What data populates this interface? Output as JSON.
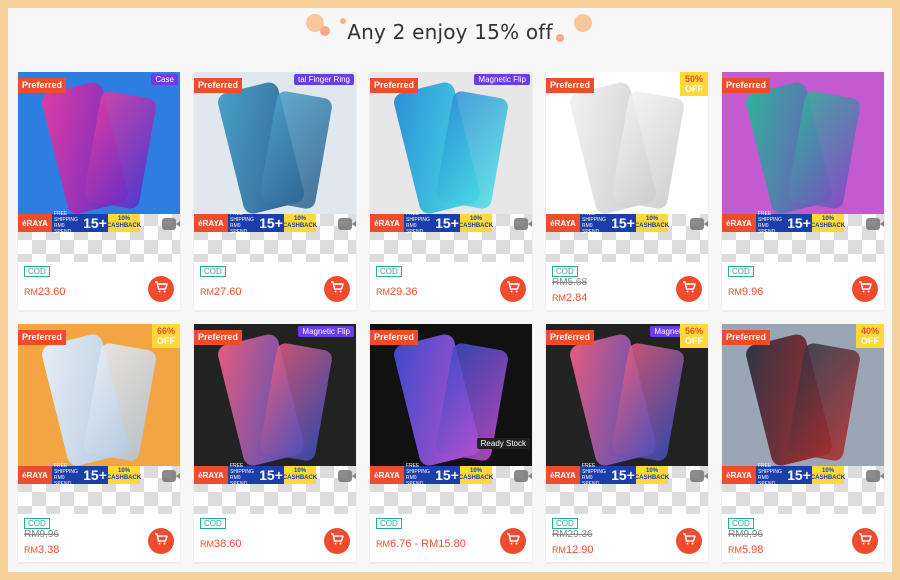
{
  "header": {
    "title": "Any 2 enjoy 15% off"
  },
  "common": {
    "preferred": "Preferred",
    "cod": "COD",
    "raya": "éRAYA",
    "free_shipping": "FREE SHIPPING",
    "ship_min": "RM0 SPEND",
    "ship_amt": "15+",
    "cashback_pct": "10%",
    "cashback": "CASHBACK",
    "currency": "RM"
  },
  "products": [
    {
      "price": "23.60",
      "old_price": "",
      "label": "Case",
      "discount": "",
      "off": "",
      "colors": [
        "#e33ba3",
        "#5a2dc8",
        "#2d7ee0"
      ]
    },
    {
      "price": "27.60",
      "old_price": "",
      "label": "tal Finger Ring",
      "discount": "",
      "off": "",
      "colors": [
        "#4aa0c9",
        "#2e5f8d",
        "#dfe8ef"
      ]
    },
    {
      "price": "29.36",
      "old_price": "",
      "label": "Magnetic Flip",
      "discount": "",
      "off": "",
      "colors": [
        "#2c8fd6",
        "#4de0e6",
        "#e7e7e7"
      ]
    },
    {
      "price": "2.84",
      "old_price": "RM5.68",
      "label": "",
      "discount": "50%",
      "off": "OFF",
      "colors": [
        "#f3f3f3",
        "#c9c9c9",
        "#ffffff"
      ]
    },
    {
      "price": "9.96",
      "old_price": "",
      "label": "",
      "discount": "",
      "off": "",
      "colors": [
        "#2fb39b",
        "#7a4bc1",
        "#c35ad0"
      ]
    },
    {
      "price": "3.38",
      "old_price": "RM9.96",
      "label": "",
      "discount": "66%",
      "off": "OFF",
      "colors": [
        "#e8eef5",
        "#b0c7df",
        "#f3a543"
      ]
    },
    {
      "price": "38.60",
      "old_price": "",
      "label": "Magnetic Flip",
      "discount": "",
      "off": "",
      "colors": [
        "#e55c7f",
        "#3d4fbf",
        "#222222"
      ]
    },
    {
      "price": "6.76 - RM15.80",
      "old_price": "",
      "label": "Ready Stock",
      "discount": "",
      "off": "",
      "colors": [
        "#3b4cc9",
        "#c24fd1",
        "#111111"
      ]
    },
    {
      "price": "12.90",
      "old_price": "RM29.36",
      "label": "Magnetic Flip",
      "discount": "56%",
      "off": "OFF",
      "colors": [
        "#e55c7f",
        "#3d4fbf",
        "#222222"
      ]
    },
    {
      "price": "5.98",
      "old_price": "RM9.96",
      "label": "",
      "discount": "40%",
      "off": "OFF",
      "colors": [
        "#2f3544",
        "#b12c2c",
        "#9aa6b5"
      ]
    }
  ],
  "icons": {
    "cart": "cart-icon",
    "video": "video-icon"
  },
  "colors": {
    "brand": "#ee4d2d",
    "cod": "#26aa99",
    "ribbon": "#ffd839",
    "background": "#f6d19a"
  }
}
